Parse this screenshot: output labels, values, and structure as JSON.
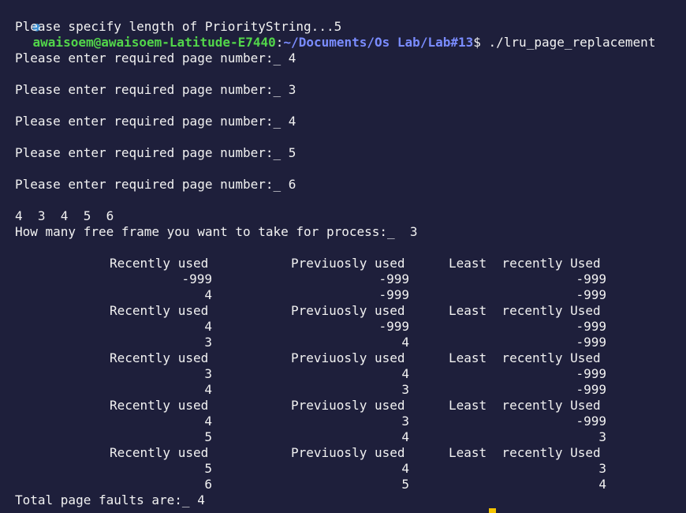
{
  "prompt": {
    "dot": "●",
    "user_host": "awaisoem@awaisoem-Latitude-E7440",
    "colon": ":",
    "path": "~/Documents/Os Lab/Lab#13",
    "symbol": "$",
    "command": " ./lru_page_replacement"
  },
  "output": {
    "length_prompt": "Please specify length of PriorityString...5",
    "page_prompts": [
      "Please enter required page number:_ 4",
      "Please enter required page number:_ 3",
      "Please enter required page number:_ 4",
      "Please enter required page number:_ 5",
      "Please enter required page number:_ 6"
    ],
    "sequence": "4  3  4  5  6",
    "frames_prompt": "How many free frame you want to take for process:_  3",
    "headers": {
      "recent": "Recently used",
      "previous": "Previuosly used",
      "least": "Least  recently Used"
    },
    "steps": [
      {
        "rows": [
          [
            "-999",
            "-999",
            "-999"
          ],
          [
            "4",
            "-999",
            "-999"
          ]
        ]
      },
      {
        "rows": [
          [
            "4",
            "-999",
            "-999"
          ],
          [
            "3",
            "4",
            "-999"
          ]
        ]
      },
      {
        "rows": [
          [
            "3",
            "4",
            "-999"
          ],
          [
            "4",
            "3",
            "-999"
          ]
        ]
      },
      {
        "rows": [
          [
            "4",
            "3",
            "-999"
          ],
          [
            "5",
            "4",
            "3"
          ]
        ]
      },
      {
        "rows": [
          [
            "5",
            "4",
            "3"
          ],
          [
            "6",
            "5",
            "4"
          ]
        ]
      }
    ],
    "total_faults": "Total page faults are:_ 4"
  },
  "colors": {
    "background": "#1e1f3b",
    "text": "#f2f2f2",
    "user": "#52d64a",
    "path": "#7a8cff",
    "cursor": "#f5c400"
  }
}
